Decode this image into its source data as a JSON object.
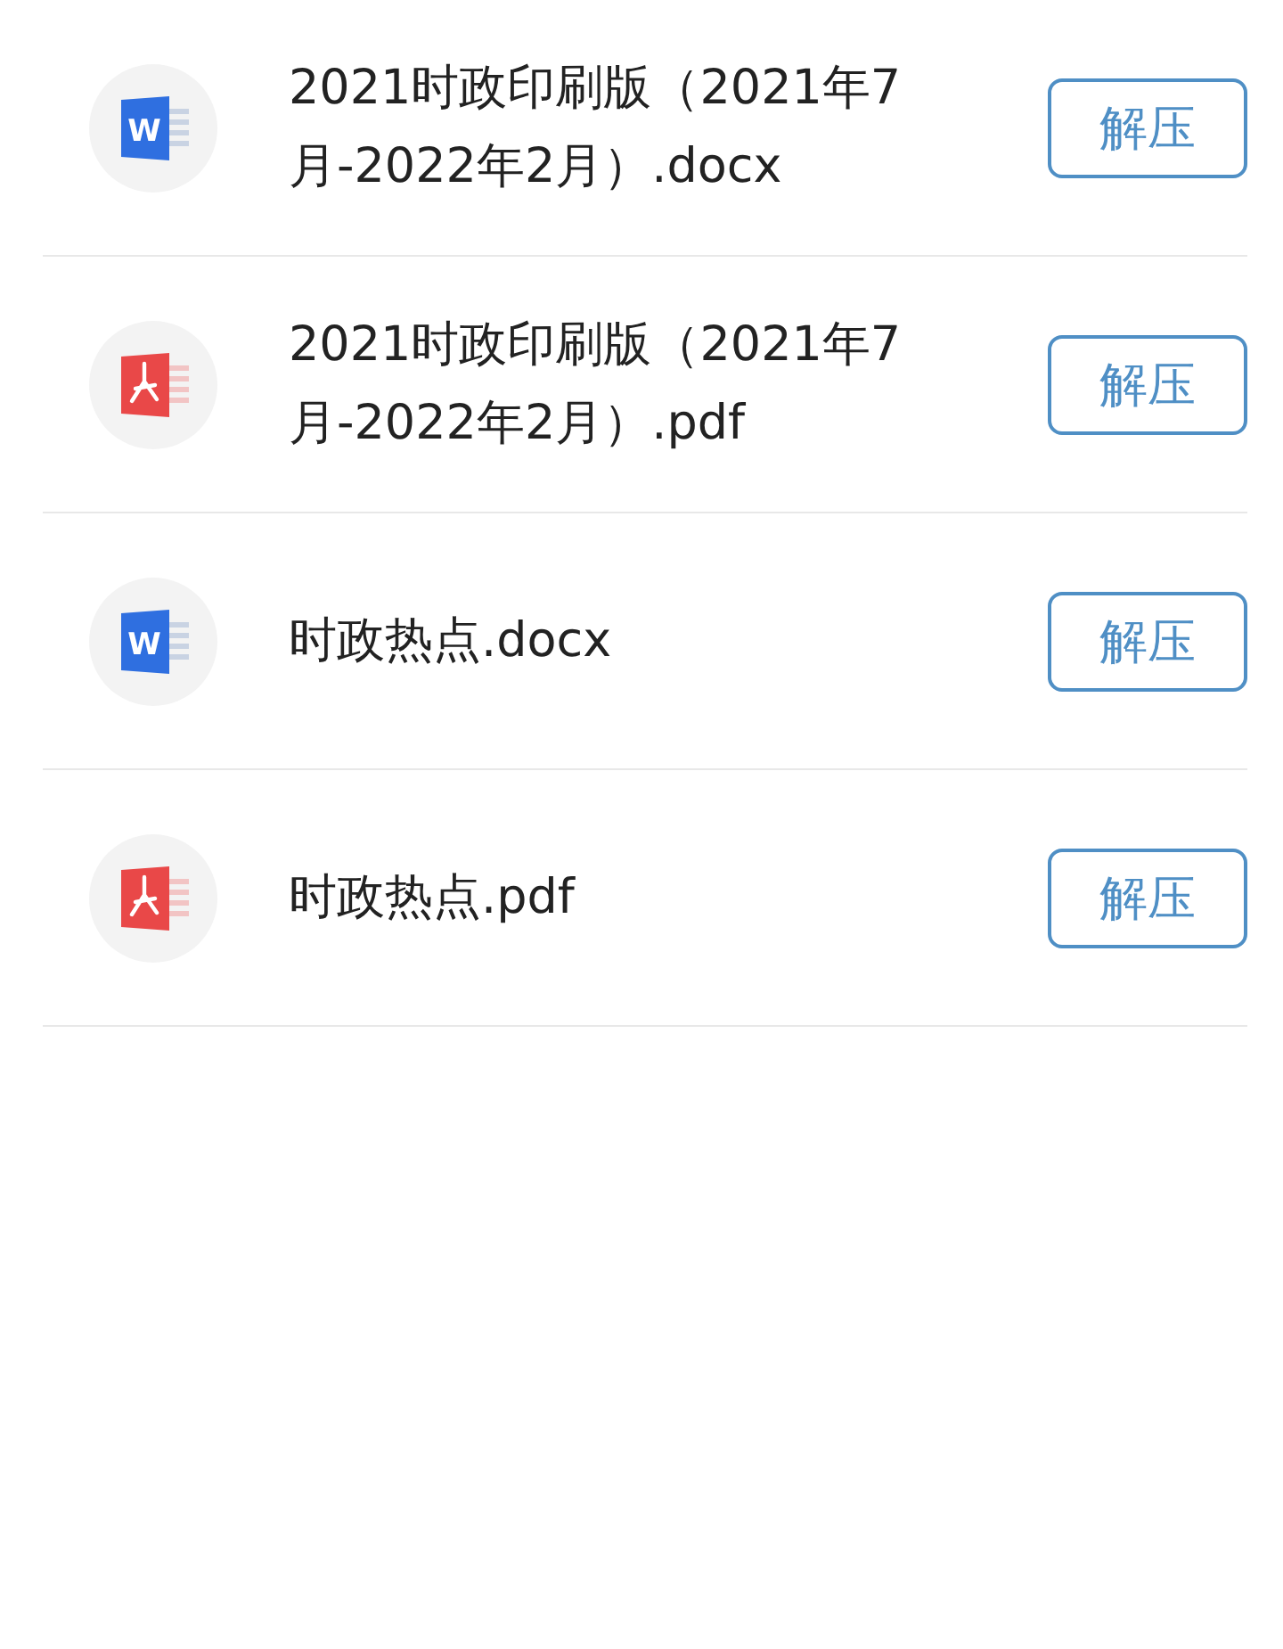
{
  "files": [
    {
      "kind": "word",
      "icon_letter": "W",
      "name": "2021时政印刷版（2021年7月-2022年2月）.docx",
      "button": "解压"
    },
    {
      "kind": "pdf",
      "name": "2021时政印刷版（2021年7月-2022年2月）.pdf",
      "button": "解压"
    },
    {
      "kind": "word",
      "icon_letter": "W",
      "name": "时政热点.docx",
      "button": "解压"
    },
    {
      "kind": "pdf",
      "name": "时政热点.pdf",
      "button": "解压"
    }
  ]
}
